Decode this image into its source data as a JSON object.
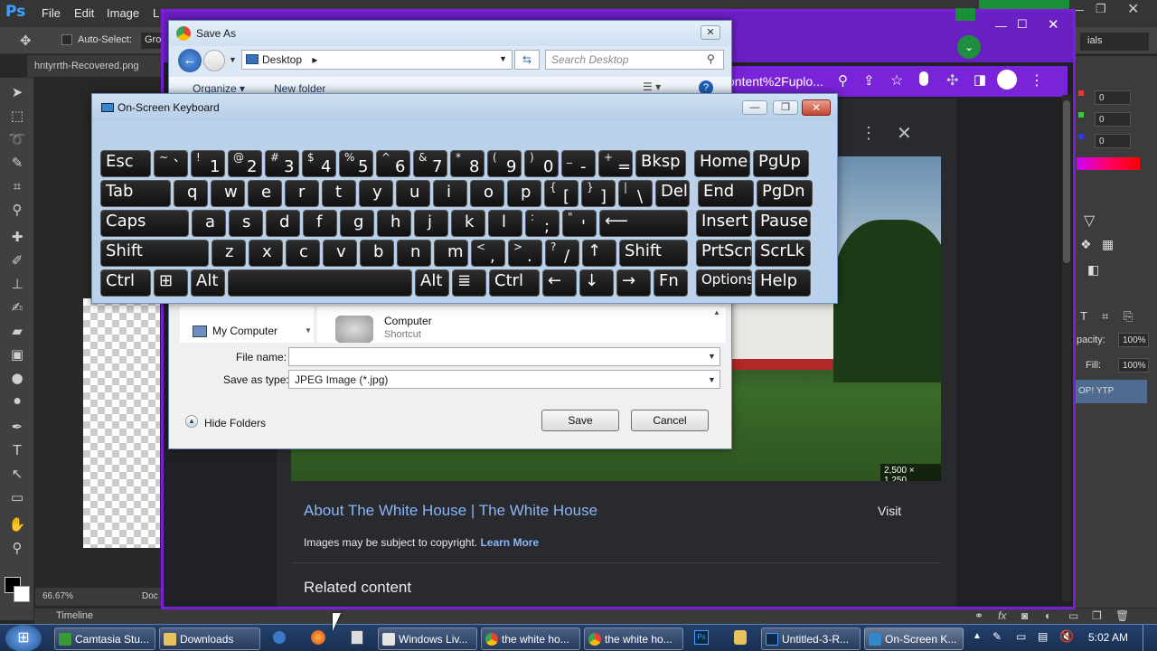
{
  "photoshop": {
    "logo": "Ps",
    "menu": [
      "File",
      "Edit",
      "Image",
      "L"
    ],
    "options": {
      "auto_select": "Auto-Select:",
      "group": "Gro"
    },
    "doc_tab": "hntyrrth-Recovered.png",
    "zoom": "66.67%",
    "doc_label": "Doc",
    "right_panel": {
      "values": [
        "0",
        "0",
        "0"
      ],
      "opacity_label": "pacity:",
      "opacity": "100%",
      "fill_label": "Fill:",
      "fill": "100%",
      "layer_name": "OP! YTP",
      "als": "ials"
    },
    "timeline": "Timeline"
  },
  "chrome": {
    "url_fragment": "ontent%2Fuplo...",
    "image_size": "2,500 × 1,250",
    "result_title": "About The White House | The White House",
    "visit": "Visit",
    "copyright": "Images may be subject to copyright.",
    "learn_more": "Learn More",
    "related": "Related content"
  },
  "save_as": {
    "title": "Save As",
    "location": "Desktop",
    "search_placeholder": "Search Desktop",
    "organize": "Organize ▾",
    "new_folder": "New folder",
    "my_computer": "My Computer",
    "item_name": "Computer",
    "item_type": "Shortcut",
    "file_name_label": "File name:",
    "file_name_value": "",
    "save_type_label": "Save as type:",
    "save_type_value": "JPEG Image (*.jpg)",
    "hide_folders": "Hide Folders",
    "save": "Save",
    "cancel": "Cancel"
  },
  "osk": {
    "title": "On-Screen Keyboard",
    "rows": [
      [
        [
          "Esc",
          ""
        ],
        [
          "`",
          "~"
        ],
        [
          "1",
          "!"
        ],
        [
          "2",
          "@"
        ],
        [
          "3",
          "#"
        ],
        [
          "4",
          "$"
        ],
        [
          "5",
          "%"
        ],
        [
          "6",
          "^"
        ],
        [
          "7",
          "&"
        ],
        [
          "8",
          "*"
        ],
        [
          "9",
          "("
        ],
        [
          "0",
          ")"
        ],
        [
          "-",
          "_"
        ],
        [
          "=",
          "+"
        ],
        [
          "Bksp",
          ""
        ],
        [
          "Home",
          ""
        ],
        [
          "PgUp",
          ""
        ]
      ],
      [
        [
          "Tab",
          ""
        ],
        [
          "q",
          ""
        ],
        [
          "w",
          ""
        ],
        [
          "e",
          ""
        ],
        [
          "r",
          ""
        ],
        [
          "t",
          ""
        ],
        [
          "y",
          ""
        ],
        [
          "u",
          ""
        ],
        [
          "i",
          ""
        ],
        [
          "o",
          ""
        ],
        [
          "p",
          ""
        ],
        [
          "[",
          "{"
        ],
        [
          "]",
          "}"
        ],
        [
          "\\",
          "|"
        ],
        [
          "Del",
          ""
        ],
        [
          "End",
          ""
        ],
        [
          "PgDn",
          ""
        ]
      ],
      [
        [
          "Caps",
          ""
        ],
        [
          "a",
          ""
        ],
        [
          "s",
          ""
        ],
        [
          "d",
          ""
        ],
        [
          "f",
          ""
        ],
        [
          "g",
          ""
        ],
        [
          "h",
          ""
        ],
        [
          "j",
          ""
        ],
        [
          "k",
          ""
        ],
        [
          "l",
          ""
        ],
        [
          ";",
          ":"
        ],
        [
          "'",
          "\""
        ],
        [
          "⟵",
          ""
        ],
        [
          "Insert",
          ""
        ],
        [
          "Pause",
          ""
        ]
      ],
      [
        [
          "Shift",
          ""
        ],
        [
          "z",
          ""
        ],
        [
          "x",
          ""
        ],
        [
          "c",
          ""
        ],
        [
          "v",
          ""
        ],
        [
          "b",
          ""
        ],
        [
          "n",
          ""
        ],
        [
          "m",
          ""
        ],
        [
          ",",
          "<"
        ],
        [
          ".",
          ">"
        ],
        [
          "/",
          "?"
        ],
        [
          "↑",
          ""
        ],
        [
          "Shift",
          ""
        ],
        [
          "PrtScn",
          ""
        ],
        [
          "ScrLk",
          ""
        ]
      ],
      [
        [
          "Ctrl",
          ""
        ],
        [
          "⊞",
          ""
        ],
        [
          "Alt",
          ""
        ],
        [
          "",
          ""
        ],
        [
          "Alt",
          ""
        ],
        [
          "≣",
          ""
        ],
        [
          "Ctrl",
          ""
        ],
        [
          "←",
          ""
        ],
        [
          "↓",
          ""
        ],
        [
          "→",
          ""
        ],
        [
          "Fn",
          ""
        ],
        [
          "Options",
          ""
        ],
        [
          "Help",
          ""
        ]
      ]
    ]
  },
  "taskbar": {
    "items": [
      "Camtasia Stu...",
      "Downloads",
      "Windows Liv...",
      "the white ho...",
      "the white ho...",
      "Untitled-3-R...",
      "On-Screen K..."
    ],
    "clock": "5:02 AM"
  },
  "colors": {
    "chrome_purple": "#7b1fd6",
    "link_blue": "#8ab4f8",
    "osk_bg": "#b9d1ea"
  }
}
